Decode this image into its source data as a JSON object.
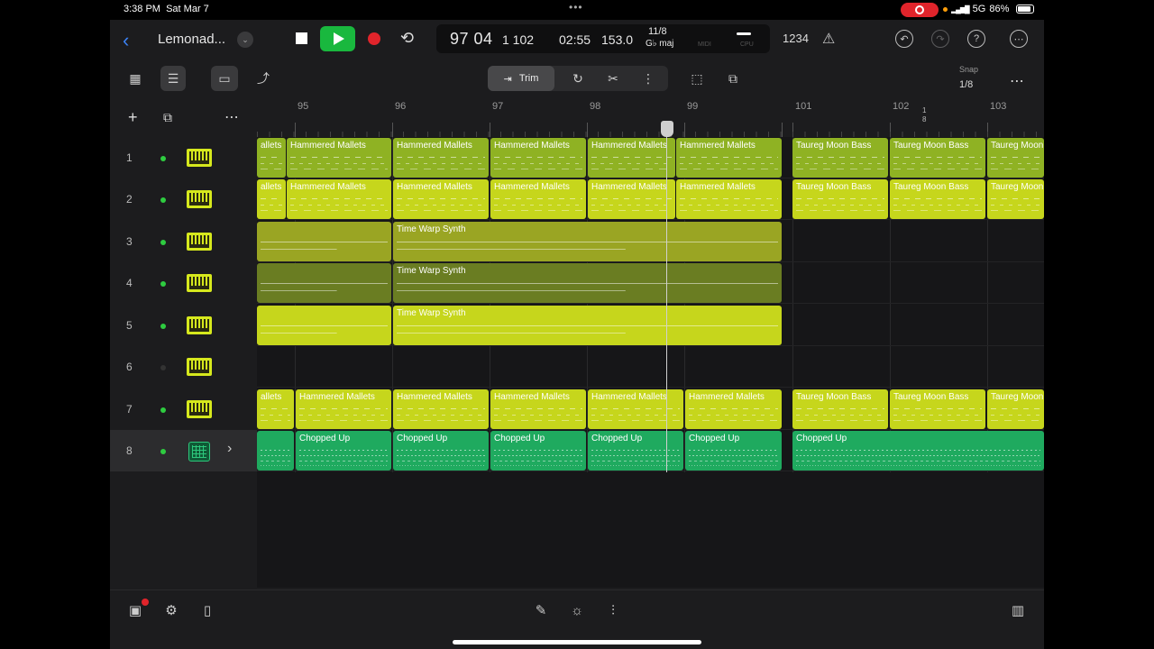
{
  "status": {
    "time": "3:38 PM",
    "date": "Sat Mar 7",
    "network": "5G",
    "battery": "86%"
  },
  "header": {
    "song_title": "Lemonad...",
    "lcd": {
      "bar_beat": "97 04",
      "division_tick": "1 102",
      "time": "02:55",
      "tempo": "153.0",
      "time_signature": "11/8",
      "key": "G♭ maj",
      "midi_label": "MIDI",
      "cpu_label": "CPU"
    },
    "count_in": "1234"
  },
  "toolbar": {
    "trim_label": "Trim",
    "snap_label": "Snap",
    "snap_value": "1/8"
  },
  "ruler": {
    "bars": [
      "95",
      "96",
      "97",
      "98",
      "99",
      "101",
      "102",
      "103"
    ],
    "time_sig_top": "1",
    "time_sig_bottom": "8"
  },
  "tracks": [
    {
      "number": "1",
      "type": "keyboard",
      "active": true
    },
    {
      "number": "2",
      "type": "keyboard",
      "active": true
    },
    {
      "number": "3",
      "type": "keyboard",
      "active": true
    },
    {
      "number": "4",
      "type": "keyboard",
      "active": true
    },
    {
      "number": "5",
      "type": "keyboard",
      "active": true
    },
    {
      "number": "6",
      "type": "keyboard",
      "active": false
    },
    {
      "number": "7",
      "type": "keyboard",
      "active": true
    },
    {
      "number": "8",
      "type": "drum",
      "active": true
    }
  ],
  "regions": {
    "r1": [
      "allets",
      "Hammered Mallets",
      "Hammered Mallets",
      "Hammered Mallets",
      "Hammered Mallets",
      "Hammered Mallets",
      "Taureg Moon Bass",
      "Taureg Moon Bass",
      "Taureg Moon"
    ],
    "r2": [
      "allets",
      "Hammered Mallets",
      "Hammered Mallets",
      "Hammered Mallets",
      "Hammered Mallets",
      "Hammered Mallets",
      "Taureg Moon Bass",
      "Taureg Moon Bass",
      "Taureg Moon"
    ],
    "r3": [
      "Time Warp Synth"
    ],
    "r4": [
      "Time Warp Synth"
    ],
    "r5": [
      "Time Warp Synth"
    ],
    "r7": [
      "allets",
      "Hammered Mallets",
      "Hammered Mallets",
      "Hammered Mallets",
      "Hammered Mallets",
      "Hammered Mallets",
      "Taureg Moon Bass",
      "Taureg Moon Bass",
      "Taureg Moon"
    ],
    "r8": [
      "Chopped Up",
      "Chopped Up",
      "Chopped Up",
      "Chopped Up",
      "Chopped Up",
      "Chopped Up"
    ]
  },
  "colors": {
    "mallets_green": "#8fb223",
    "mallets_yellow": "#c6d61c",
    "synth_olive": "#9aa523",
    "synth_dark": "#6a7d22",
    "drums_green": "#1faa5f",
    "play_green": "#19b83e",
    "record_red": "#e0242b"
  }
}
